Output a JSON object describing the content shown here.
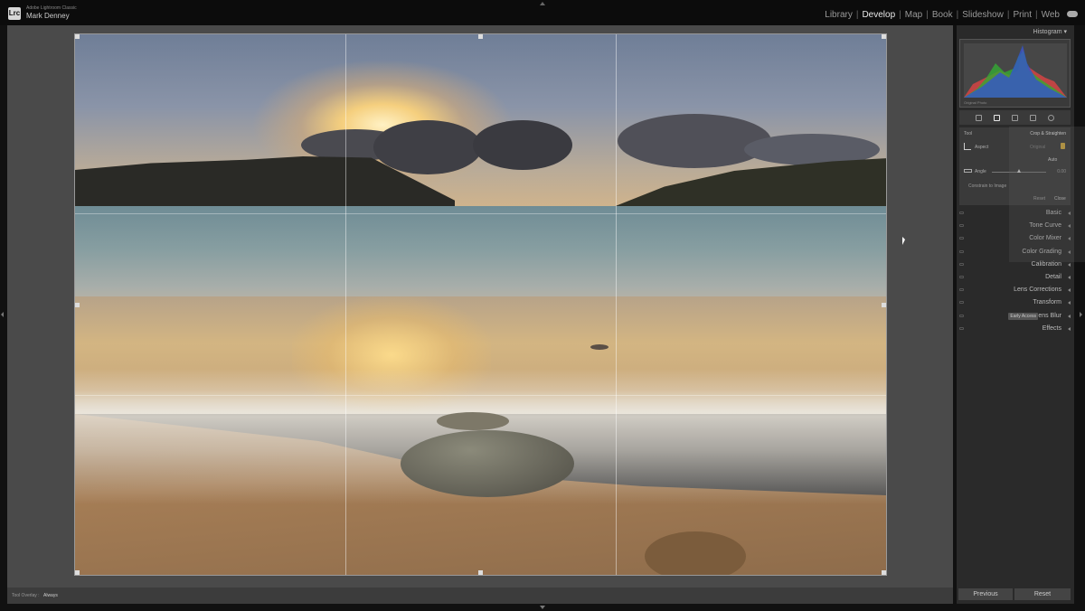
{
  "app": {
    "logo_text": "Lrc",
    "app_name": "Adobe Lightroom Classic",
    "user_name": "Mark Denney"
  },
  "modules": [
    {
      "label": "Library",
      "active": false
    },
    {
      "label": "Develop",
      "active": true
    },
    {
      "label": "Map",
      "active": false
    },
    {
      "label": "Book",
      "active": false
    },
    {
      "label": "Slideshow",
      "active": false
    },
    {
      "label": "Print",
      "active": false
    },
    {
      "label": "Web",
      "active": false
    }
  ],
  "toolbar": {
    "tool_overlay_label": "Tool Overlay :",
    "tool_overlay_value": "Always"
  },
  "histogram": {
    "title": "Histogram",
    "original_photo_label": "Original Photo"
  },
  "crop": {
    "tool_label": "Tool",
    "title": "Crop & Straighten",
    "aspect_label": "Aspect",
    "aspect_value": "Original",
    "auto_label": "Auto",
    "angle_label": "Angle",
    "angle_value": "0.00",
    "constrain_label": "Constrain to Image",
    "reset_label": "Reset",
    "close_label": "Close"
  },
  "sections": [
    {
      "label": "Basic"
    },
    {
      "label": "Tone Curve"
    },
    {
      "label": "Color Mixer"
    },
    {
      "label": "Color Grading"
    },
    {
      "label": "Calibration"
    },
    {
      "label": "Detail"
    },
    {
      "label": "Lens Corrections"
    },
    {
      "label": "Transform"
    },
    {
      "label": "Lens Blur",
      "badge": "Early Access"
    },
    {
      "label": "Effects"
    }
  ],
  "buttons": {
    "previous": "Previous",
    "reset": "Reset"
  },
  "colors": {
    "accent_lock": "#c9a23c",
    "panel_bg": "#2a2a2a",
    "canvas_bg": "#4a4a4a"
  }
}
